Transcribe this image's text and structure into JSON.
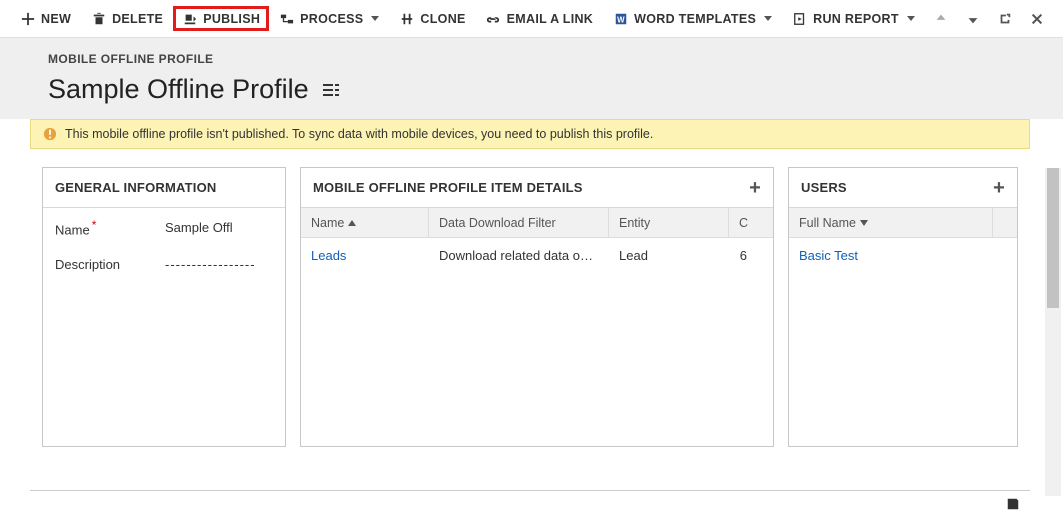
{
  "toolbar": {
    "new": "NEW",
    "delete": "DELETE",
    "publish": "PUBLISH",
    "process": "PROCESS",
    "clone": "CLONE",
    "email": "EMAIL A LINK",
    "word": "WORD TEMPLATES",
    "run": "RUN REPORT"
  },
  "breadcrumb": "MOBILE OFFLINE PROFILE",
  "title": "Sample Offline Profile",
  "warning": "This mobile offline profile isn't published. To sync data with mobile devices, you need to publish this profile.",
  "general": {
    "header": "GENERAL INFORMATION",
    "name_label": "Name",
    "name_value": "Sample Offl",
    "desc_label": "Description",
    "desc_value": "-----------------"
  },
  "details": {
    "header": "MOBILE OFFLINE PROFILE ITEM DETAILS",
    "col_name": "Name",
    "col_filter": "Data Download Filter",
    "col_entity": "Entity",
    "col_c": "C",
    "rows": [
      {
        "name": "Leads",
        "filter": "Download related data on…",
        "entity": "Lead",
        "c": "6"
      }
    ]
  },
  "users": {
    "header": "USERS",
    "col_fullname": "Full Name",
    "rows": [
      {
        "fullname": "Basic Test"
      }
    ]
  }
}
